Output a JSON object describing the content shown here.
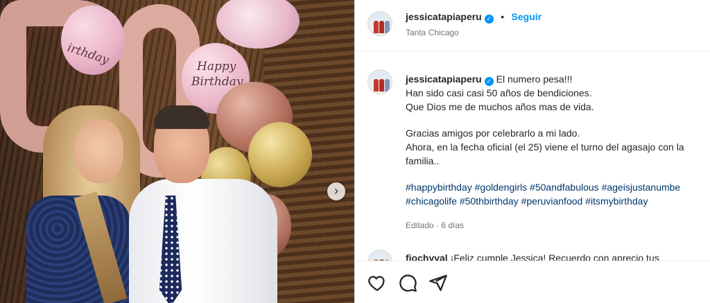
{
  "post": {
    "photo_alt_icon": "carousel-next-icon",
    "next_glyph": "›"
  },
  "header": {
    "username": "jessicatapiaperu",
    "separator": "•",
    "follow_label": "Seguir",
    "location": "Tanta Chicago"
  },
  "caption": {
    "username": "jessicatapiaperu",
    "lines": [
      "El numero pesa!!!",
      "Han sido casi casi 50 años de bendiciones.",
      "Que Dios me de muchos años mas de vida.",
      "Gracias amigos por celebrarlo a mi lado.",
      "Ahora, en la fecha oficial (el 25) viene el turno del agasajo con la",
      "familia.."
    ],
    "hashtags": [
      "#happybirthday",
      "#goldengirls",
      "#50andfabulous",
      "#ageisjustanumbe",
      "#chicagolife",
      "#50thbirthday",
      "#peruvianfood",
      "#itsmybirthday"
    ],
    "meta": "Editado · 6 días"
  },
  "comment": {
    "username": "fiochyval",
    "text": "¡Feliz cumple Jessica!  Recuerdo con aprecio tus"
  },
  "photo": {
    "balloon_text_1": "Happy",
    "balloon_text_2": "Birthday",
    "balloon_text_3": "irthday"
  },
  "colors": {
    "accent": "#0095f6",
    "hashtag": "#00376b",
    "muted": "#737373"
  }
}
